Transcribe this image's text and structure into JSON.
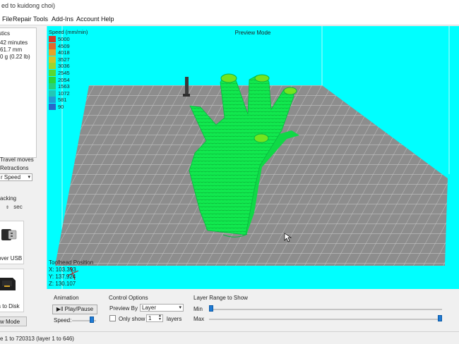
{
  "window": {
    "title": "ed to kuidong choi)"
  },
  "menu": [
    "File",
    "Repair",
    "Tools",
    "Add-Ins",
    "Account",
    "Help"
  ],
  "left_panel": {
    "stats_label": "stics",
    "stats": [
      "42 minutes",
      "61.7 mm",
      "0 g (0.22 lb)"
    ],
    "show_travel": "Travel moves",
    "show_retractions": "Retractions",
    "color_by": "r Speed",
    "tracking_label": "acking",
    "tracking_unit": "sec",
    "usb_label": "over USB",
    "disk_label": "s to Disk",
    "view_mode": "w Mode"
  },
  "viewport": {
    "mode_label": "Preview Mode",
    "legend_title": "Speed (mm/min)",
    "legend": [
      {
        "value": "5000",
        "color": "#d63a2a"
      },
      {
        "value": "4509",
        "color": "#e2682c"
      },
      {
        "value": "4018",
        "color": "#e5a229"
      },
      {
        "value": "3527",
        "color": "#d3c526"
      },
      {
        "value": "3036",
        "color": "#9fd52c"
      },
      {
        "value": "2545",
        "color": "#5ad733"
      },
      {
        "value": "2054",
        "color": "#2dd63c"
      },
      {
        "value": "1563",
        "color": "#26d27c"
      },
      {
        "value": "1072",
        "color": "#22c7b5"
      },
      {
        "value": "581",
        "color": "#229bd5"
      },
      {
        "value": "90",
        "color": "#2a66c9"
      }
    ],
    "toolhead_title": "Toolhead Position",
    "toolhead_x": "X: 103.393",
    "toolhead_y": "Y: 137.924",
    "toolhead_z": "Z: 130.107",
    "model_color": "#11e84e",
    "bed_color": "#8c8c8c"
  },
  "controls": {
    "animation_label": "Animation",
    "play_label": "Play/Pause",
    "speed_label": "Speed:",
    "speed_level": 0.9,
    "control_options_label": "Control Options",
    "preview_by_label": "Preview By",
    "preview_by_value": "Layer",
    "only_show_label": "Only show",
    "only_show_value": "1",
    "layers_label": "layers",
    "layer_range_label": "Layer Range to Show",
    "min_label": "Min",
    "max_label": "Max",
    "min_level": 0.0,
    "max_level": 1.0
  },
  "status": {
    "text": "e 1 to 720313 (layer 1 to 646)"
  }
}
